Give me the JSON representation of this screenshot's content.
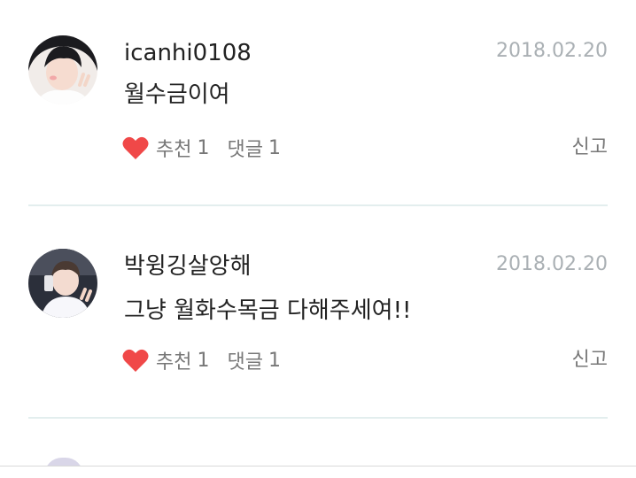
{
  "comments": [
    {
      "username": "icanhi0108",
      "date": "2018.02.20",
      "text": "월수금이여",
      "like_label": "추천",
      "like_count": "1",
      "reply_label": "댓글",
      "reply_count": "1",
      "report_label": "신고",
      "avatar_icon": "user-photo-avatar"
    },
    {
      "username": "박윙깅살앙해",
      "date": "2018.02.20",
      "text": "그냥 월화수목금 다해주세여!!",
      "like_label": "추천",
      "like_count": "1",
      "reply_label": "댓글",
      "reply_count": "1",
      "report_label": "신고",
      "avatar_icon": "user-photo-avatar"
    }
  ],
  "colors": {
    "heart": "#f04848",
    "divider": "#e3eeee",
    "date": "#aab0b4",
    "muted": "#777777",
    "text": "#222222"
  },
  "icons": {
    "like": "heart-icon"
  }
}
